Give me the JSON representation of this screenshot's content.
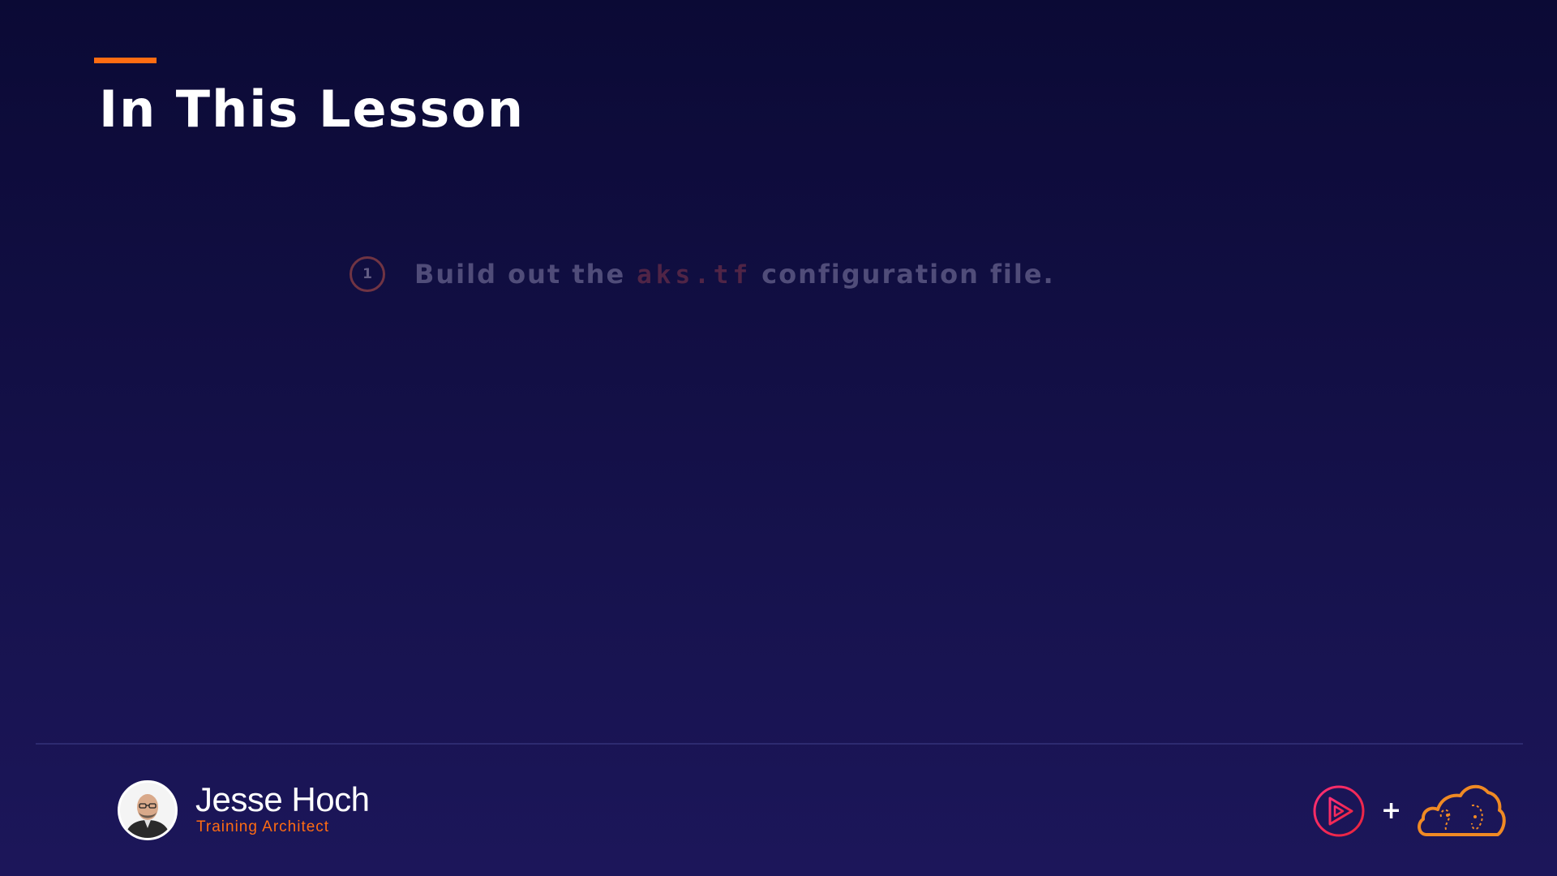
{
  "slide": {
    "title": "In This Lesson",
    "accent_color": "#ff6c12"
  },
  "objectives": [
    {
      "number": "1",
      "text_before": "Build out the",
      "code": "aks.tf",
      "text_after": "configuration file."
    }
  ],
  "presenter": {
    "name": "Jesse Hoch",
    "role": "Training Architect",
    "avatar_icon": "presenter-photo"
  },
  "branding": {
    "plus_sign": "+",
    "logos": [
      "pluralsight-play-icon",
      "a-cloud-guru-cloud-icon"
    ]
  }
}
